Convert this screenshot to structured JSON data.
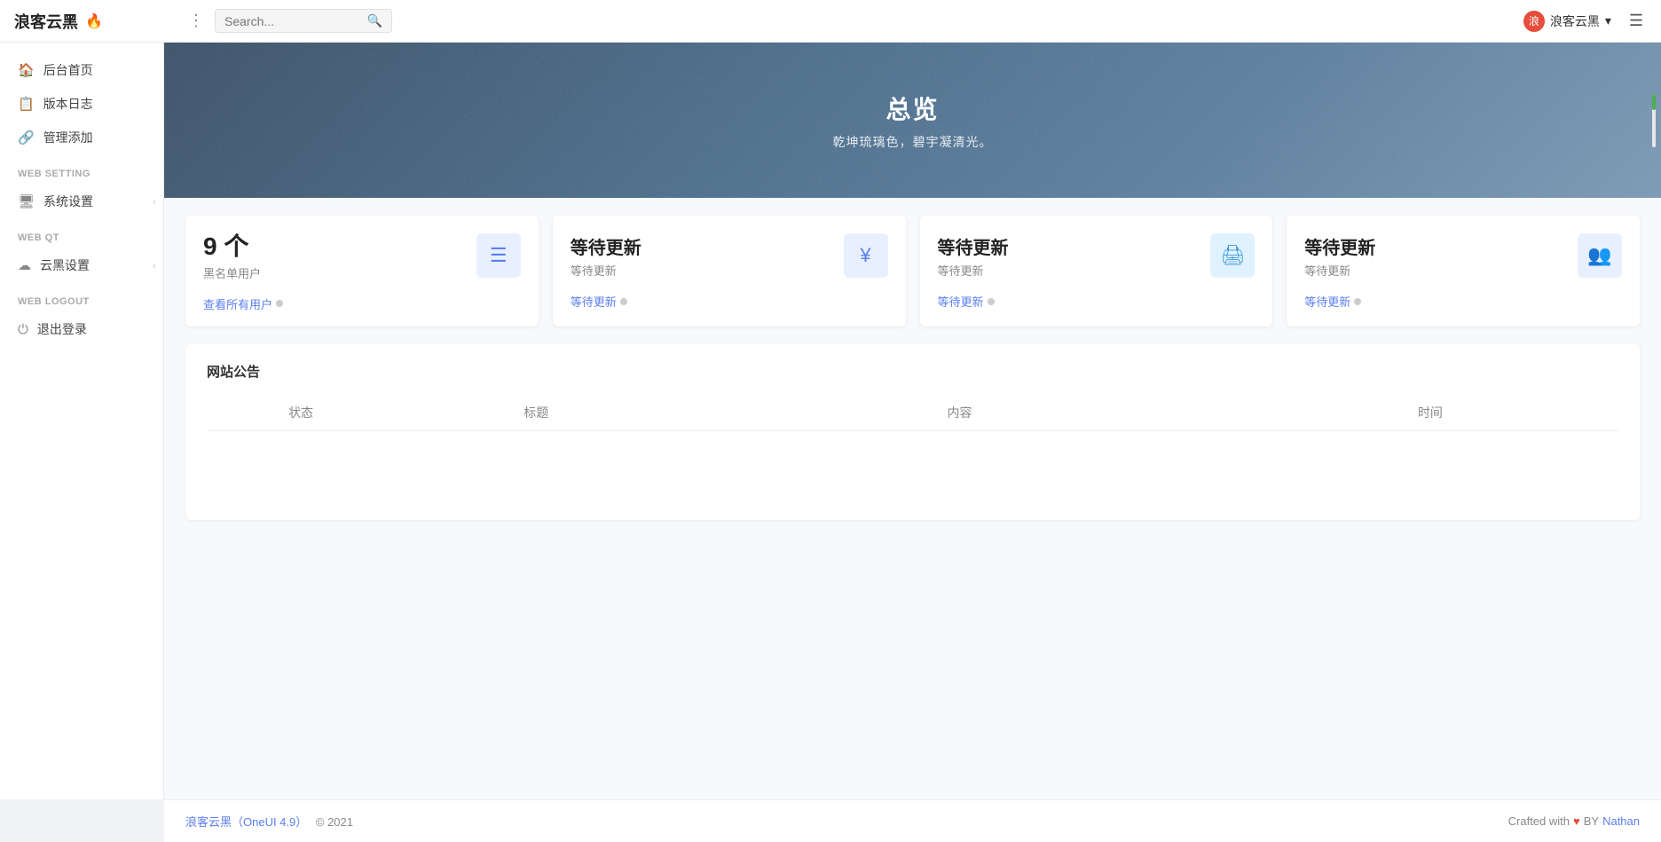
{
  "brand": {
    "name": "浪客云黑",
    "flame": "🔥"
  },
  "topnav": {
    "dots_label": "⋮",
    "search_placeholder": "Search...",
    "user_label": "浪客云黑",
    "chevron": "▾",
    "hamburger": "☰"
  },
  "sidebar": {
    "sections": [
      {
        "items": [
          {
            "icon": "🏠",
            "label": "后台首页",
            "name": "dashboard"
          },
          {
            "icon": "📋",
            "label": "版本日志",
            "name": "changelog"
          },
          {
            "icon": "🔗",
            "label": "管理添加",
            "name": "manage-add"
          }
        ]
      },
      {
        "label": "WEB SETTING",
        "items": [
          {
            "icon": "🖥",
            "label": "系统设置",
            "name": "system-settings",
            "has_arrow": true
          }
        ]
      },
      {
        "label": "WEB QT",
        "items": [
          {
            "icon": "☁",
            "label": "云黑设置",
            "name": "cloud-settings",
            "has_arrow": true
          }
        ]
      },
      {
        "label": "WEB LOGOUT",
        "items": [
          {
            "icon": "⏻",
            "label": "退出登录",
            "name": "logout"
          }
        ]
      }
    ]
  },
  "hero": {
    "title": "总览",
    "subtitle": "乾坤琉璃色，碧宇凝清光。"
  },
  "stats": [
    {
      "value": "9 个",
      "label": "黑名单用户",
      "icon": "☰",
      "icon_color": "blue",
      "link_text": "查看所有用户",
      "name": "blacklist-users"
    },
    {
      "value": "等待更新",
      "label": "等待更新",
      "icon": "¥",
      "icon_color": "blue",
      "link_text": "等待更新",
      "name": "stat-2"
    },
    {
      "value": "等待更新",
      "label": "等待更新",
      "icon": "🖨",
      "icon_color": "lightblue",
      "link_text": "等待更新",
      "name": "stat-3"
    },
    {
      "value": "等待更新",
      "label": "等待更新",
      "icon": "👥",
      "icon_color": "blue",
      "link_text": "等待更新",
      "name": "stat-4"
    }
  ],
  "announcements": {
    "title": "网站公告",
    "columns": [
      "状态",
      "标题",
      "内容",
      "时间"
    ],
    "rows": []
  },
  "footer": {
    "brand_text": "浪客云黑（OneUI 4.9）",
    "copy": "© 2021",
    "crafted": "Crafted with",
    "by": "BY",
    "author": "Nathan"
  }
}
